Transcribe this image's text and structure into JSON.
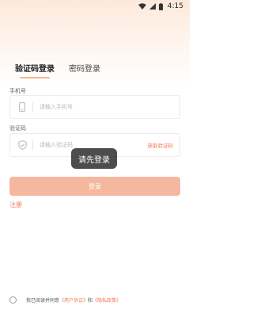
{
  "status_bar": {
    "time": "4:15",
    "icons": [
      "wifi-icon",
      "signal-icon",
      "battery-icon"
    ]
  },
  "tabs": [
    {
      "label": "验证码登录",
      "active": true
    },
    {
      "label": "密码登录",
      "active": false
    }
  ],
  "phone": {
    "label": "手机号",
    "placeholder": "请输入手机号",
    "value": "",
    "icon": "phone-icon"
  },
  "code": {
    "label": "验证码",
    "placeholder": "请输入验证码",
    "value": "",
    "icon": "shield-icon",
    "get_code_label": "获取验证码"
  },
  "toast": "请先登录",
  "login_button": "登录",
  "register_link": "注册",
  "agreement": {
    "prefix": "我已阅读并同意",
    "user_agreement": "《用户协议》",
    "and": "和",
    "privacy_policy": "《隐私政策》"
  },
  "colors": {
    "accent": "#ef7a52",
    "button": "#f6b79f",
    "tab_underline": "#f3b38e"
  }
}
